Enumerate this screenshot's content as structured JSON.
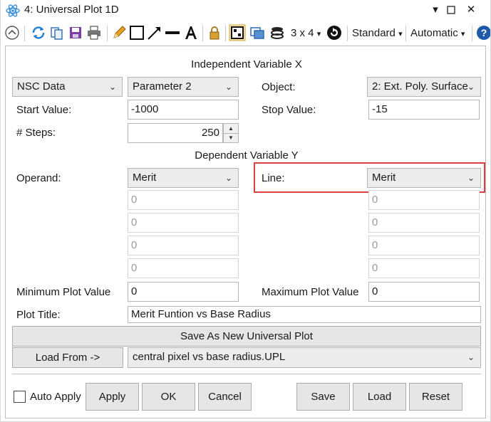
{
  "window": {
    "title": "4: Universal Plot 1D",
    "minimize": "▾",
    "restore": "☐",
    "close": "✕"
  },
  "toolbar": {
    "layout": "3 x 4",
    "layout_arrow": "▾",
    "standard": "Standard",
    "standard_arrow": "▾",
    "automatic": "Automatic",
    "automatic_arrow": "▾"
  },
  "independent": {
    "heading": "Independent Variable X",
    "type_select": "NSC Data",
    "param_select": "Parameter 2",
    "object_label": "Object:",
    "object_select": "2: Ext. Poly. Surface",
    "start_label": "Start Value:",
    "start_value": "-1000",
    "stop_label": "Stop Value:",
    "stop_value": "-15",
    "steps_label": "# Steps:",
    "steps_value": "250"
  },
  "dependent": {
    "heading": "Dependent Variable Y",
    "operand_label": "Operand:",
    "operand_select": "Merit",
    "line_label": "Line:",
    "line_select": "Merit",
    "left_params": [
      "0",
      "0",
      "0",
      "0"
    ],
    "right_params": [
      "0",
      "0",
      "0",
      "0"
    ]
  },
  "plot": {
    "min_label": "Minimum Plot Value",
    "min_value": "0",
    "max_label": "Maximum Plot Value",
    "max_value": "0",
    "title_label": "Plot Title:",
    "title_value": "Merit Funtion vs Base Radius",
    "save_new": "Save As New Universal Plot",
    "load_from": "Load From ->",
    "load_file": "central pixel vs base radius.UPL"
  },
  "footer": {
    "auto_apply": "Auto Apply",
    "apply": "Apply",
    "ok": "OK",
    "cancel": "Cancel",
    "save": "Save",
    "load": "Load",
    "reset": "Reset"
  },
  "colors": {
    "highlight": "#d94040",
    "accent": "#1e7fd6"
  }
}
